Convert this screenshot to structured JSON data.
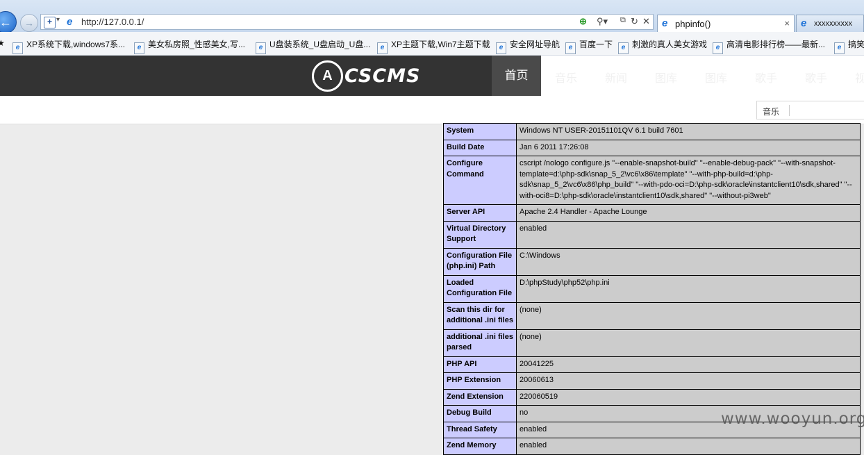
{
  "browser": {
    "url": "http://127.0.0.1/",
    "tabs": [
      {
        "title": "phpinfo()",
        "close": "×"
      },
      {
        "title": "xxxxxxxxxx"
      }
    ],
    "favorites": [
      "XP系统下载,windows7系...",
      "美女私房照_性感美女,写...",
      "U盘装系统_U盘启动_U盘...",
      "XP主题下载,Win7主题下载",
      "安全网址导航",
      "百度一下",
      "刺激的真人美女游戏",
      "高清电影排行榜——最新...",
      "搞笑"
    ]
  },
  "site": {
    "logo_text": "CSCMS",
    "nav": [
      "首页",
      "音乐",
      "新闻",
      "图库",
      "图库",
      "歌手",
      "歌手",
      "视"
    ],
    "search_label": "音乐"
  },
  "phpinfo": [
    {
      "key": "System",
      "value": "Windows NT USER-20151101QV 6.1 build 7601"
    },
    {
      "key": "Build Date",
      "value": "Jan 6 2011 17:26:08"
    },
    {
      "key": "Configure Command",
      "value": "cscript /nologo configure.js \"--enable-snapshot-build\" \"--enable-debug-pack\" \"--with-snapshot-template=d:\\php-sdk\\snap_5_2\\vc6\\x86\\template\" \"--with-php-build=d:\\php-sdk\\snap_5_2\\vc6\\x86\\php_build\" \"--with-pdo-oci=D:\\php-sdk\\oracle\\instantclient10\\sdk,shared\" \"--with-oci8=D:\\php-sdk\\oracle\\instantclient10\\sdk,shared\" \"--without-pi3web\""
    },
    {
      "key": "Server API",
      "value": "Apache 2.4 Handler - Apache Lounge"
    },
    {
      "key": "Virtual Directory Support",
      "value": "enabled"
    },
    {
      "key": "Configuration File (php.ini) Path",
      "value": "C:\\Windows"
    },
    {
      "key": "Loaded Configuration File",
      "value": "D:\\phpStudy\\php52\\php.ini"
    },
    {
      "key": "Scan this dir for additional .ini files",
      "value": "(none)"
    },
    {
      "key": "additional .ini files parsed",
      "value": "(none)"
    },
    {
      "key": "PHP API",
      "value": "20041225"
    },
    {
      "key": "PHP Extension",
      "value": "20060613"
    },
    {
      "key": "Zend Extension",
      "value": "220060519"
    },
    {
      "key": "Debug Build",
      "value": "no"
    },
    {
      "key": "Thread Safety",
      "value": "enabled"
    },
    {
      "key": "Zend Memory",
      "value": "enabled"
    }
  ],
  "watermark": "www.wooyun.org"
}
